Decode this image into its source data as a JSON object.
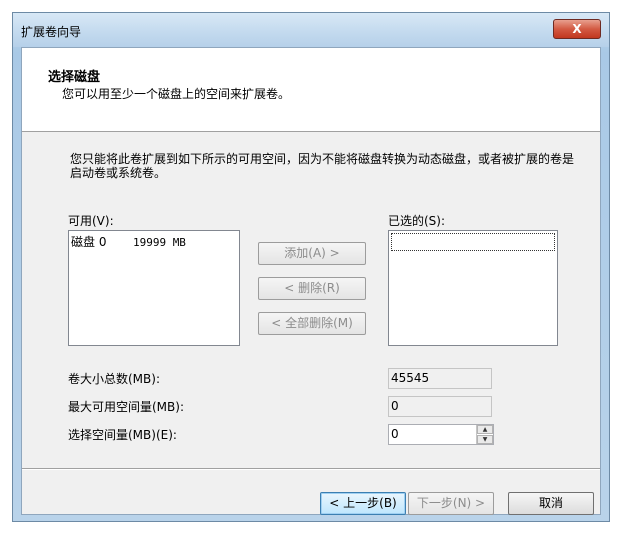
{
  "window": {
    "title": "扩展卷向导",
    "close_glyph": "X"
  },
  "header": {
    "title": "选择磁盘",
    "description": "您可以用至少一个磁盘上的空间来扩展卷。"
  },
  "info": "您只能将此卷扩展到如下所示的可用空间，因为不能将磁盘转换为动态磁盘，或者被扩展的卷是启动卷或系统卷。",
  "available": {
    "label": "可用(V):",
    "items": [
      {
        "name": "磁盘 0",
        "size": "19999 MB"
      }
    ]
  },
  "selected": {
    "label": "已选的(S):"
  },
  "buttons": {
    "add": "添加(A) >",
    "remove": "< 删除(R)",
    "remove_all": "< 全部删除(M)",
    "back": "< 上一步(B)",
    "next": "下一步(N) >",
    "cancel": "取消"
  },
  "fields": {
    "total_label": "卷大小总数(MB):",
    "total_value": "45545",
    "max_label": "最大可用空间量(MB):",
    "max_value": "0",
    "select_label": "选择空间量(MB)(E):",
    "select_value": "0"
  }
}
